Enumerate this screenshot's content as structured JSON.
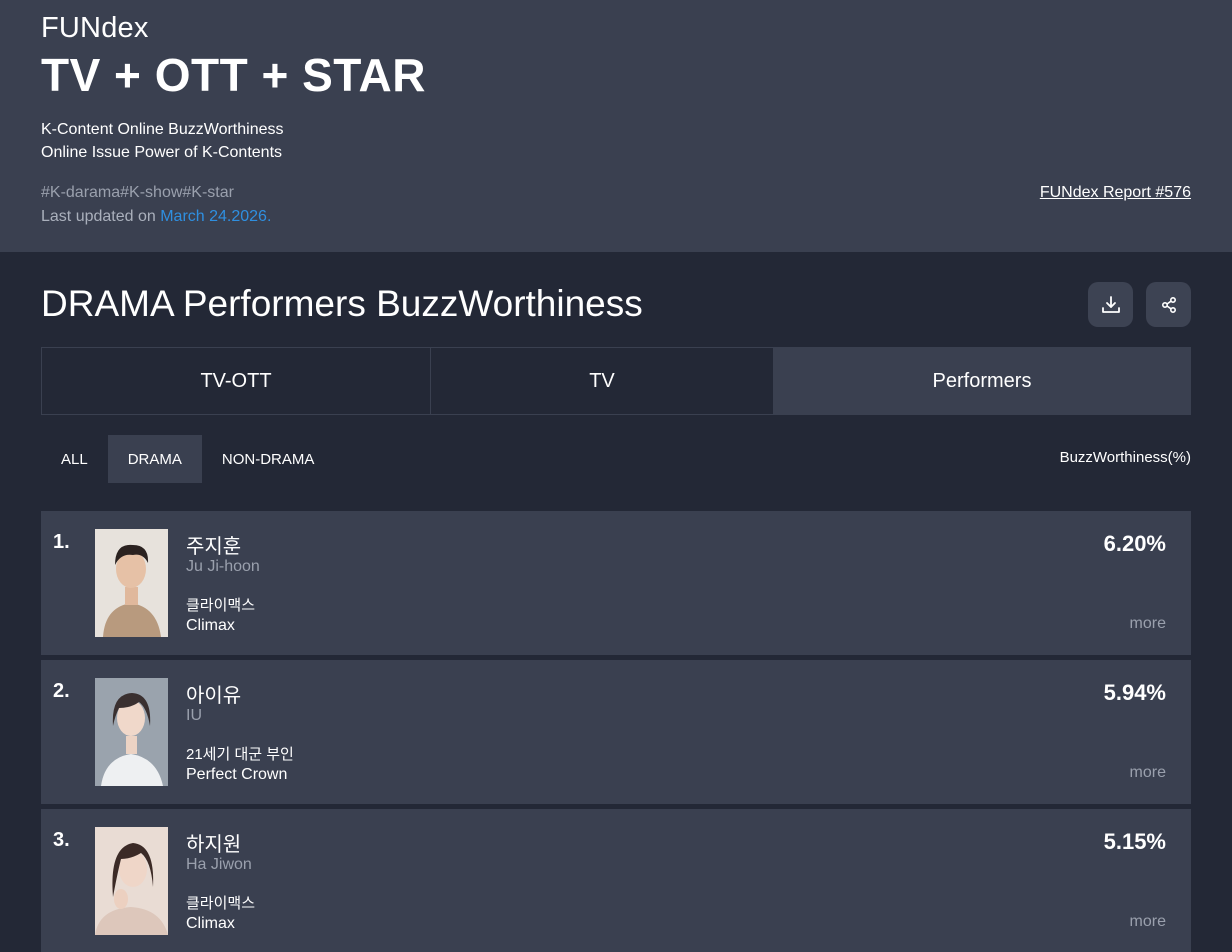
{
  "header": {
    "brand": "FUNdex",
    "headline": "TV + OTT + STAR",
    "desc1": "K-Content Online BuzzWorthiness",
    "desc2": "Online Issue Power of K-Contents",
    "tags": "#K-darama#K-show#K-star",
    "updated_prefix": "Last updated on ",
    "updated_date": "March 24.2026.",
    "report_link": "FUNdex Report #576"
  },
  "section": {
    "title": "DRAMA Performers BuzzWorthiness",
    "download_icon": "download-icon",
    "share_icon": "share-icon"
  },
  "tabs": [
    {
      "label": "TV-OTT"
    },
    {
      "label": "TV"
    },
    {
      "label": "Performers",
      "active": true
    }
  ],
  "filters": [
    {
      "label": "ALL"
    },
    {
      "label": "DRAMA",
      "active": true
    },
    {
      "label": "NON-DRAMA"
    }
  ],
  "column_header": "BuzzWorthiness(%)",
  "rows": [
    {
      "rank": "1.",
      "name_ko": "주지훈",
      "name_en": "Ju Ji-hoon",
      "show_ko": "클라이맥스",
      "show_en": "Climax",
      "pct": "6.20%",
      "more": "more"
    },
    {
      "rank": "2.",
      "name_ko": "아이유",
      "name_en": "IU",
      "show_ko": "21세기 대군 부인",
      "show_en": "Perfect Crown",
      "pct": "5.94%",
      "more": "more"
    },
    {
      "rank": "3.",
      "name_ko": "하지원",
      "name_en": "Ha Jiwon",
      "show_ko": "클라이맥스",
      "show_en": "Climax",
      "pct": "5.15%",
      "more": "more"
    }
  ],
  "colors": {
    "hero_bg": "#3a4050",
    "page_bg": "#232836",
    "link_blue": "#2f8fe0",
    "muted": "#9aa0ad"
  }
}
